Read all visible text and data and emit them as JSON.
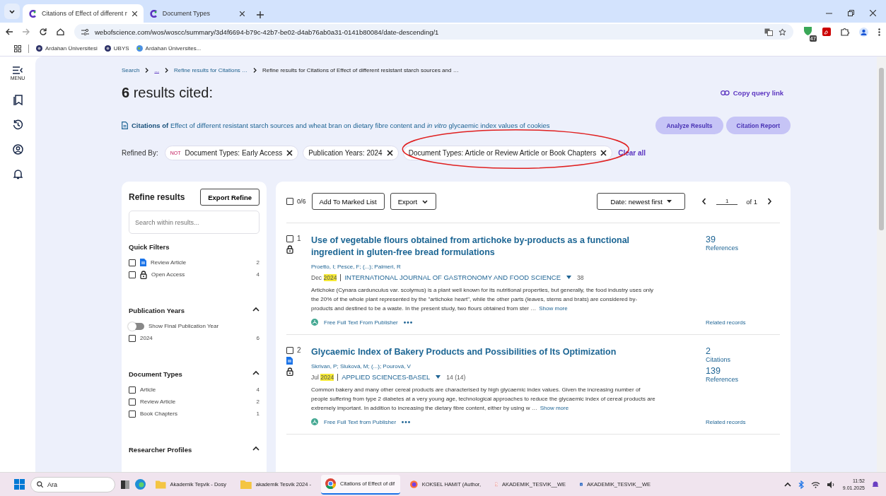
{
  "browser": {
    "tabs": [
      {
        "title": "Citations of Effect of different r",
        "selected": true
      },
      {
        "title": "Document Types",
        "selected": false
      }
    ],
    "url": "webofscience.com/wos/woscc/summary/3d4f6694-b79c-42b7-be02-d4ab76ab0a31-0141b80084/date-descending/1",
    "extension_badge": "47",
    "bookmarks": [
      "Ardahan Üniversitesi",
      "UBYS",
      "Ardahan Üniversites..."
    ]
  },
  "rail": {
    "menu_label": "MENU"
  },
  "breadcrumb": [
    "Search",
    "...",
    "Refine results for Citations …",
    "Refine results for Citations of Effect of different resistant starch sources and …"
  ],
  "heading": {
    "count": "6",
    "text": "results cited:"
  },
  "copy_link": "Copy query link",
  "citations": {
    "label": "Citations of",
    "title": "Effect of different resistant starch sources and wheat bran on dietary fibre content and *in vitro* glycaemic index values of cookies"
  },
  "actions": [
    "Analyze Results",
    "Citation Report"
  ],
  "refined_by": {
    "label": "Refined By:",
    "chips": [
      {
        "prefix": "NOT",
        "text": "Document Types: Early Access",
        "annotated": false
      },
      {
        "text": "Publication Years: 2024",
        "annotated": false
      },
      {
        "text": "Document Types: Article or Review Article or Book Chapters",
        "annotated": true
      }
    ],
    "clear": "Clear all"
  },
  "refine": {
    "title": "Refine results",
    "export": "Export Refine",
    "search_placeholder": "Search within results...",
    "sections": [
      {
        "title": "Quick Filters",
        "items": [
          {
            "label": "Review Article",
            "count": "2",
            "checked": false,
            "kind": "review"
          },
          {
            "label": "Open Access",
            "count": "4",
            "checked": false,
            "kind": "open_access"
          }
        ]
      },
      {
        "title": "Publication Years",
        "expanded": true,
        "toggle": {
          "label": "Show Final Publication Year",
          "on": false
        },
        "items": [
          {
            "label": "2024",
            "count": "6",
            "checked": false
          }
        ]
      },
      {
        "title": "Document Types",
        "expanded": true,
        "items": [
          {
            "label": "Article",
            "count": "4",
            "checked": false
          },
          {
            "label": "Review Article",
            "count": "2",
            "checked": false
          },
          {
            "label": "Book Chapters",
            "count": "1",
            "checked": false
          }
        ]
      },
      {
        "title": "Researcher Profiles",
        "expanded": true
      }
    ]
  },
  "toolbar": {
    "selected_count": "0/6",
    "all_checked": false,
    "buttons": [
      "Add To Marked List",
      "Export"
    ],
    "sort": "Date: newest first",
    "page": "1",
    "of": "of 1"
  },
  "records": [
    {
      "number": "1",
      "checked": false,
      "review": false,
      "open_access": true,
      "title": "Use of vegetable flours obtained from artichoke by-products as a functional ingredient in gluten-free bread formulations",
      "authors": "Proetto, I; Pesce, F; (...); Palmeri, R",
      "month": "Dec",
      "year": "2024",
      "journal": "INTERNATIONAL JOURNAL OF GASTRONOMY AND FOOD SCIENCE",
      "journal_count": "38",
      "abstract": "Artichoke (Cynara cardunculus var. scolymus) is a plant well known for its nutritional properties, but generally, the food industry uses only the 20% of the whole plant represented by the \"artichoke heart\", while the other parts (leaves, stems and brats) are considered by-products and destined to be a waste. In the present study, two flours obtained from ster …",
      "show_more": "Show more",
      "full_text": "Free Full Text From Publisher",
      "metrics": [
        {
          "value": "39",
          "label": "References"
        }
      ],
      "related": "Related records"
    },
    {
      "number": "2",
      "checked": false,
      "review": true,
      "open_access": true,
      "title": "Glycaemic Index of Bakery Products and Possibilities of Its Optimization",
      "authors": "Skrivan, P; Sluková, M; (...); Pourová, V",
      "month": "Jul",
      "year": "2024",
      "journal": "APPLIED SCIENCES-BASEL",
      "journal_count": "14 (14)",
      "abstract": "Common bakery and many other cereal products are characterised by high glycaemic index values. Given the increasing number of people suffering from type 2 diabetes at a very young age, technological approaches to reduce the glycaemic index of cereal products are extremely important. In addition to increasing the dietary fibre content, either by using w …",
      "show_more": "Show more",
      "full_text": "Free Full Text from Publisher",
      "metrics": [
        {
          "value": "2",
          "label": "Citations"
        },
        {
          "value": "139",
          "label": "References"
        }
      ],
      "related": "Related records"
    }
  ],
  "taskbar": {
    "search": "Ara",
    "apps": [
      {
        "label": "Akademik Teşvik - Dosy",
        "kind": "folder",
        "active": false
      },
      {
        "label": "akademik Tesvik 2024 -",
        "kind": "folder",
        "active": false
      },
      {
        "label": "Citations of Effect of dif",
        "kind": "chrome",
        "active": true
      },
      {
        "label": "KOKSEL HAMIT (Author,",
        "kind": "firefox",
        "active": false
      },
      {
        "label": "AKADEMIK_TESVIK__WE",
        "kind": "pdf",
        "active": false
      },
      {
        "label": "AKADEMIK_TESVIK__WE",
        "kind": "word",
        "active": false
      }
    ],
    "time": "11:52",
    "date": "9.01.2025"
  }
}
